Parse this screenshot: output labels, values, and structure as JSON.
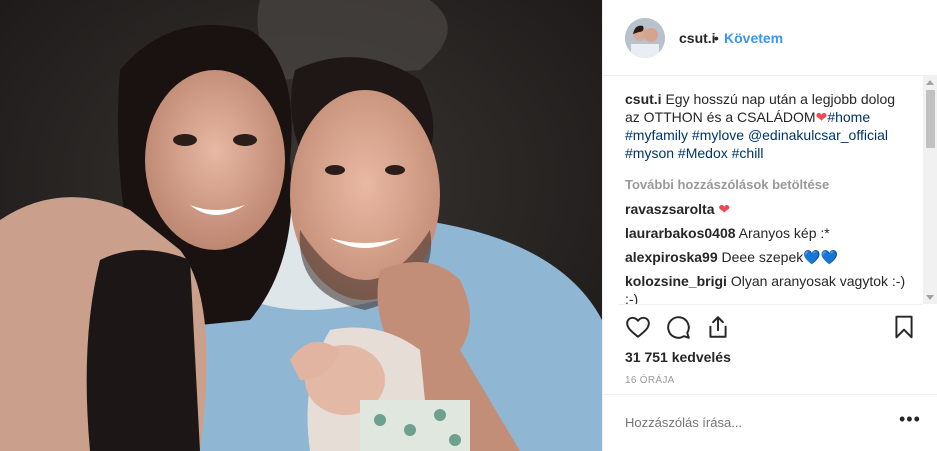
{
  "post": {
    "username": "csut.i",
    "dot": "•",
    "follow_label": "Követem",
    "caption": {
      "username": "csut.i",
      "text": "Egy hosszú nap után a legjobb dolog az OTTHON és a CSALÁDOM",
      "heart": "❤",
      "tags": [
        "#home",
        "#myfamily",
        "#mylove",
        "@edinakulcsar_official",
        "#myson",
        "#Medox",
        "#chill"
      ]
    },
    "load_more_label": "További hozzászólások betöltése",
    "comments": [
      {
        "user": "ravaszsarolta",
        "text": "",
        "emoji": "❤",
        "emoji_color": "red"
      },
      {
        "user": "laurarbakos0408",
        "text": "Aranyos kép :*",
        "emoji": "",
        "emoji_color": ""
      },
      {
        "user": "alexpiroska99",
        "text": "Deee szepek",
        "emoji": "💙💙",
        "emoji_color": "blue"
      },
      {
        "user": "kolozsine_brigi",
        "text": "Olyan aranyosak vagytok :-) :-)",
        "emoji": "",
        "emoji_color": ""
      }
    ],
    "likes_label": "31 751 kedvelés",
    "time_label": "16 ÓRÁJA",
    "add_comment_placeholder": "Hozzászólás írása...",
    "more_options": "•••"
  },
  "icons": {
    "like": "heart-outline-icon",
    "comment": "speech-bubble-icon",
    "share": "share-upload-icon",
    "save": "bookmark-icon"
  },
  "colors": {
    "link_blue": "#3897f0",
    "tag_blue": "#003569",
    "muted": "#999999",
    "text": "#262626"
  }
}
